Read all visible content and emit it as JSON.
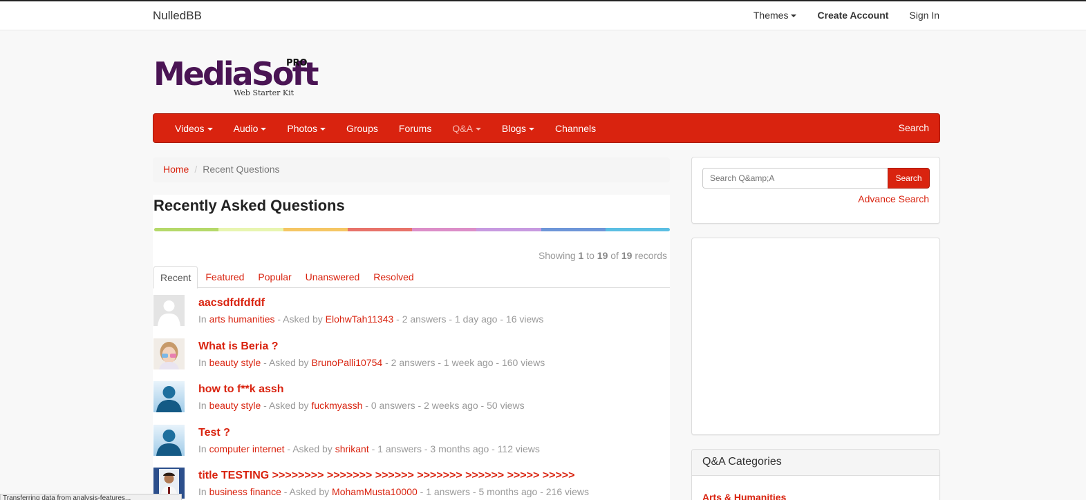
{
  "topbar": {
    "brand": "NulledBB",
    "themes": "Themes",
    "create_account": "Create Account",
    "sign_in": "Sign In"
  },
  "logo": {
    "main": "MediaSoft",
    "pro": "PRO",
    "sub": "Web Starter Kit"
  },
  "nav": {
    "items": [
      {
        "label": "Videos",
        "dropdown": true
      },
      {
        "label": "Audio",
        "dropdown": true
      },
      {
        "label": "Photos",
        "dropdown": true
      },
      {
        "label": "Groups",
        "dropdown": false
      },
      {
        "label": "Forums",
        "dropdown": false
      },
      {
        "label": "Q&A",
        "dropdown": true,
        "active": true
      },
      {
        "label": "Blogs",
        "dropdown": true
      },
      {
        "label": "Channels",
        "dropdown": false
      }
    ],
    "search": "Search",
    "accent": "#d9230f"
  },
  "breadcrumb": {
    "home": "Home",
    "current": "Recent Questions"
  },
  "main": {
    "title": "Recently Asked Questions",
    "rainbow_colors": [
      "#b5d96a",
      "#e8f5b0",
      "#f5c664",
      "#e8736a",
      "#dc8ec8",
      "#c79ae0",
      "#6e96d8",
      "#5bbfe3"
    ],
    "showing": {
      "prefix": "Showing",
      "from": "1",
      "to_word": "to",
      "to": "19",
      "of_word": "of",
      "total": "19",
      "suffix": "records"
    },
    "tabs": [
      "Recent",
      "Featured",
      "Popular",
      "Unanswered",
      "Resolved"
    ],
    "questions": [
      {
        "title": "aacsdfdfdfdf",
        "category": "arts humanities",
        "user": "ElohwTah11343",
        "stats": " - 2 answers - 1 day ago - 16 views",
        "avatar": "silhouette-gray-icon"
      },
      {
        "title": "What is Beria ?",
        "category": "beauty style",
        "user": "BrunoPalli10754",
        "stats": " - 2 answers - 1 week ago - 160 views",
        "avatar": "photo-girl-icon"
      },
      {
        "title": "how to f**k assh",
        "category": "beauty style",
        "user": "fuckmyassh",
        "stats": " - 0 answers - 2 weeks ago - 50 views",
        "avatar": "silhouette-blue-icon"
      },
      {
        "title": "Test ?",
        "category": "computer internet",
        "user": "shrikant",
        "stats": " - 1 answers - 3 months ago - 112 views",
        "avatar": "silhouette-blue-icon"
      },
      {
        "title": "title TESTING >>>>>>>> >>>>>>> >>>>>> >>>>>>> >>>>>> >>>>> >>>>>",
        "category": "business finance",
        "user": "MohamMusta10000",
        "stats": " - 1 answers - 5 months ago - 216 views",
        "avatar": "photo-man-icon"
      }
    ],
    "in_word": "In",
    "asked_by": " - Asked by "
  },
  "sidebar": {
    "search_placeholder": "Search Q&amp;A",
    "search_button": "Search",
    "advance_search": "Advance Search",
    "categories_title": "Q&A Categories",
    "first_category": "Arts & Humanities"
  },
  "statusbar": "Transferring data from analysis-features..."
}
